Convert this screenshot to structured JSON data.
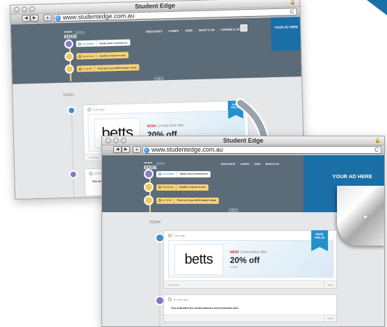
{
  "browser": {
    "title": "Student Edge",
    "url": "www.studentedge.com.au",
    "back_label": "◀",
    "forward_label": "▶",
    "add_label": "+",
    "reload_label": "C",
    "lock_glyph": "🔒"
  },
  "site": {
    "logo_small": "STUDENT",
    "logo": "EDGE",
    "nav": [
      "DISCOUNTS",
      "COMPS",
      "JOBS",
      "WHAT'S ON",
      "CAREER & LIFE"
    ],
    "ad_label": "YOUR AD HERE",
    "reminders": [
      {
        "time": "3-4 weeks",
        "text": "Study week commences"
      },
      {
        "time": "tomorrow",
        "text": "Another chance to win"
      },
      {
        "time": "in 14:00",
        "text": "Find out if you WON today's draw"
      }
    ]
  },
  "feed": {
    "section_label": "TODAY",
    "offer": {
      "time": "1 min ago",
      "brand": "betts",
      "tag": "NEW!",
      "tag_rest": "Limited time offer",
      "headline": "20% off",
      "sub": "in store",
      "ribbon_line1": "Ends",
      "ribbon_line2": "Feb 22",
      "share_label": "Share",
      "hide_label": "Hide"
    },
    "activity": {
      "time": "10 mins ago",
      "text": "You activated the email address kevin@tomail.com",
      "text_back": "You activate",
      "hide_label": "Hide"
    }
  },
  "colors": {
    "header": "#5c6b78",
    "ad": "#1a6fa6",
    "reminder_blue": "#8a7bd0",
    "reminder_yellow": "#f0c95b",
    "ribbon": "#2390d0",
    "bullet_blue": "#3f8fd1",
    "bullet_purple": "#8a70c9"
  }
}
